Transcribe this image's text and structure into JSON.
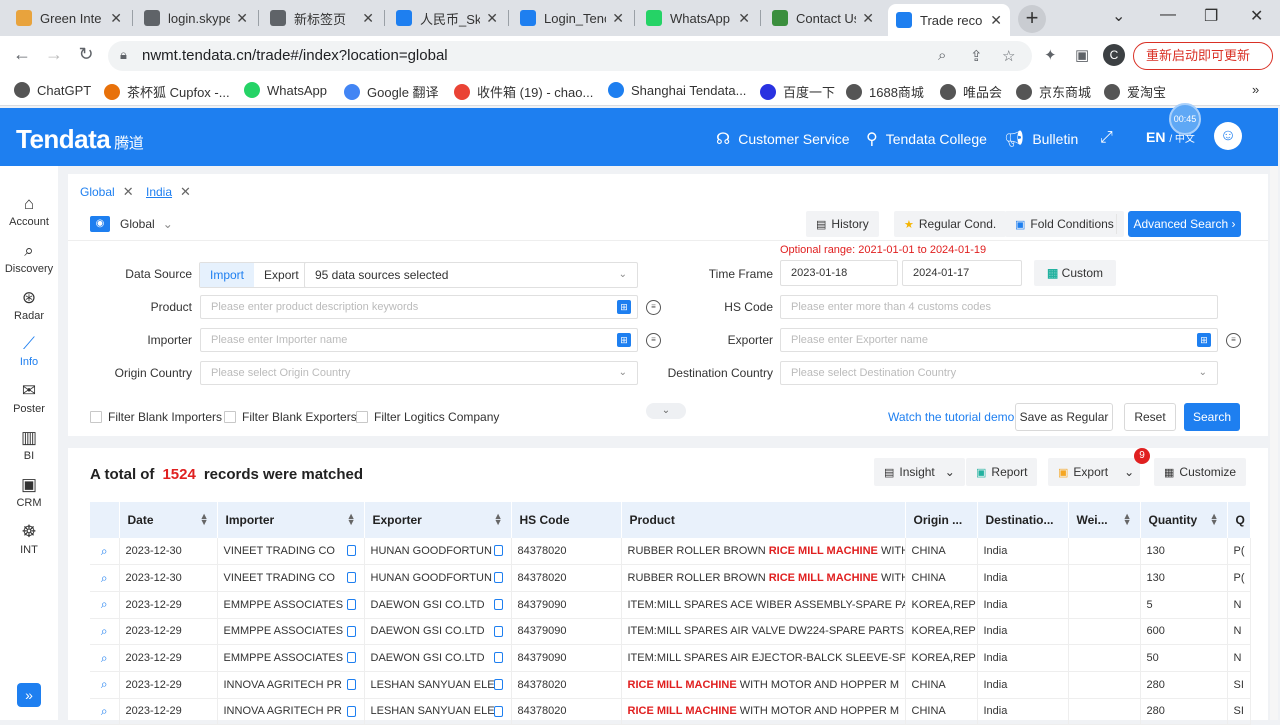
{
  "browser": {
    "tabs": [
      {
        "label": "Green Inte",
        "color": "#e8a33d"
      },
      {
        "label": "login.skype",
        "color": "#5f6368"
      },
      {
        "label": "新标签页",
        "color": "#5f6368"
      },
      {
        "label": "人民币_Sky",
        "color": "#1e7ff0"
      },
      {
        "label": "Login_Tenc",
        "color": "#1e7ff0"
      },
      {
        "label": "WhatsApp",
        "color": "#25d366"
      },
      {
        "label": "Contact Us",
        "color": "#3b8f3e"
      },
      {
        "label": "Trade reco",
        "color": "#1e7ff0"
      }
    ],
    "url": "nwmt.tendata.cn/trade#/index?location=global",
    "profile_initial": "C",
    "update_label": "重新启动即可更新",
    "bookmarks": [
      "ChatGPT",
      "茶杯狐 Cupfox -...",
      "WhatsApp",
      "Google 翻译",
      "收件箱 (19) - chao...",
      "Shanghai Tendata...",
      "百度一下",
      "1688商城",
      "唯品会",
      "京东商城",
      "爱淘宝"
    ]
  },
  "header": {
    "logo": "Tendata",
    "logo_cn": "腾道",
    "customer_service": "Customer Service",
    "college": "Tendata College",
    "bulletin": "Bulletin",
    "lang": "EN",
    "lang_alt": "/ 中文",
    "timer": "00:45"
  },
  "sidebar": {
    "items": [
      {
        "label": "Account",
        "icon": "home-icon"
      },
      {
        "label": "Discovery",
        "icon": "search-icon"
      },
      {
        "label": "Radar",
        "icon": "radar-icon"
      },
      {
        "label": "Info",
        "icon": "chart-icon"
      },
      {
        "label": "Poster",
        "icon": "mail-icon"
      },
      {
        "label": "BI",
        "icon": "bi-icon"
      },
      {
        "label": "CRM",
        "icon": "crm-icon"
      },
      {
        "label": "INT",
        "icon": "globe-icon"
      }
    ]
  },
  "page_tabs": [
    "Global",
    "India"
  ],
  "scope": "Global",
  "toolbar": {
    "history": "History",
    "regular_cond": "Regular Cond.",
    "fold_conditions": "Fold Conditions",
    "advanced_search": "Advanced Search"
  },
  "form": {
    "optional_range": "Optional range:  2021-01-01 to 2024-01-19",
    "data_source_label": "Data Source",
    "import_label": "Import",
    "export_label": "Export",
    "data_sources_value": "95 data sources selected",
    "time_frame_label": "Time Frame",
    "date_from": "2023-01-18",
    "date_to": "2024-01-17",
    "custom_label": "Custom",
    "product_label": "Product",
    "product_placeholder": "Please enter product description keywords",
    "hs_label": "HS Code",
    "hs_placeholder": "Please enter more than 4 customs codes",
    "importer_label": "Importer",
    "importer_placeholder": "Please enter Importer name",
    "exporter_label": "Exporter",
    "exporter_placeholder": "Please enter Exporter name",
    "origin_label": "Origin Country",
    "origin_placeholder": "Please select Origin Country",
    "dest_label": "Destination Country",
    "dest_placeholder": "Please select Destination Country",
    "filter_importers": "Filter Blank Importers",
    "filter_exporters": "Filter Blank Exporters",
    "filter_logistics": "Filter Logitics Company",
    "tutorial": "Watch the tutorial demo",
    "save_regular": "Save as Regular",
    "reset": "Reset",
    "search": "Search"
  },
  "results": {
    "prefix": "A total of",
    "count": "1524",
    "suffix": "records were matched",
    "insight": "Insight",
    "report": "Report",
    "export": "Export",
    "export_badge": "9",
    "customize": "Customize",
    "columns": [
      "",
      "Date",
      "Importer",
      "Exporter",
      "HS Code",
      "Product",
      "Origin ...",
      "Destinatio...",
      "Wei...",
      "Quantity",
      "Q"
    ],
    "rows": [
      {
        "date": "2023-12-30",
        "importer": "VINEET TRADING CO",
        "exporter": "HUNAN GOODFORTUN",
        "hs": "84378020",
        "p_pre": "RUBBER ROLLER BROWN ",
        "p_hl": "RICE MILL MACHINE",
        "p_post": " WITH",
        "origin": "CHINA",
        "dest": "India",
        "weight": "",
        "qty": "130",
        "q": "P("
      },
      {
        "date": "2023-12-30",
        "importer": "VINEET TRADING CO",
        "exporter": "HUNAN GOODFORTUN",
        "hs": "84378020",
        "p_pre": "RUBBER ROLLER BROWN ",
        "p_hl": "RICE MILL MACHINE",
        "p_post": " WITH",
        "origin": "CHINA",
        "dest": "India",
        "weight": "",
        "qty": "130",
        "q": "P("
      },
      {
        "date": "2023-12-29",
        "importer": "EMMPPE ASSOCIATES",
        "exporter": "DAEWON GSI CO.LTD",
        "hs": "84379090",
        "p_pre": "ITEM:MILL SPARES ACE WIBER ASSEMBLY-SPARE PART",
        "p_hl": "",
        "p_post": "",
        "origin": "KOREA,REP",
        "dest": "India",
        "weight": "",
        "qty": "5",
        "q": "N"
      },
      {
        "date": "2023-12-29",
        "importer": "EMMPPE ASSOCIATES",
        "exporter": "DAEWON GSI CO.LTD",
        "hs": "84379090",
        "p_pre": "ITEM:MILL SPARES AIR VALVE DW224-SPARE PARTS FO",
        "p_hl": "",
        "p_post": "",
        "origin": "KOREA,REP",
        "dest": "India",
        "weight": "",
        "qty": "600",
        "q": "N"
      },
      {
        "date": "2023-12-29",
        "importer": "EMMPPE ASSOCIATES",
        "exporter": "DAEWON GSI CO.LTD",
        "hs": "84379090",
        "p_pre": "ITEM:MILL SPARES AIR EJECTOR-BALCK SLEEVE-SPARE",
        "p_hl": "",
        "p_post": "",
        "origin": "KOREA,REP",
        "dest": "India",
        "weight": "",
        "qty": "50",
        "q": "N"
      },
      {
        "date": "2023-12-29",
        "importer": "INNOVA AGRITECH PR",
        "exporter": "LESHAN SANYUAN ELE",
        "hs": "84378020",
        "p_pre": "",
        "p_hl": "RICE MILL MACHINE",
        "p_post": " WITH MOTOR AND HOPPER M",
        "origin": "CHINA",
        "dest": "India",
        "weight": "",
        "qty": "280",
        "q": "SI"
      },
      {
        "date": "2023-12-29",
        "importer": "INNOVA AGRITECH PR",
        "exporter": "LESHAN SANYUAN ELE",
        "hs": "84378020",
        "p_pre": "",
        "p_hl": "RICE MILL MACHINE",
        "p_post": " WITH MOTOR AND HOPPER M",
        "origin": "CHINA",
        "dest": "India",
        "weight": "",
        "qty": "280",
        "q": "SI"
      }
    ]
  },
  "colors": {
    "primary": "#1e7ff0",
    "highlight": "#e02020"
  }
}
